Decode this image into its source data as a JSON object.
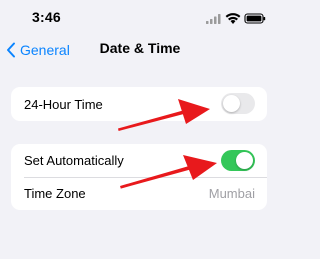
{
  "status_bar": {
    "time": "3:46",
    "icons": [
      "signal-icon",
      "wifi-icon",
      "battery-icon"
    ]
  },
  "nav": {
    "back_label": "General",
    "title": "Date & Time"
  },
  "settings": {
    "hour24": {
      "label": "24-Hour Time",
      "enabled": false
    },
    "set_automatically": {
      "label": "Set Automatically",
      "enabled": true
    },
    "time_zone": {
      "label": "Time Zone",
      "value": "Mumbai"
    }
  },
  "colors": {
    "accent": "#0a84ff",
    "switch_on": "#34c759",
    "switch_off": "#e9e9eb",
    "annotation_arrow": "#e8191c",
    "background": "#f2f2f7"
  }
}
